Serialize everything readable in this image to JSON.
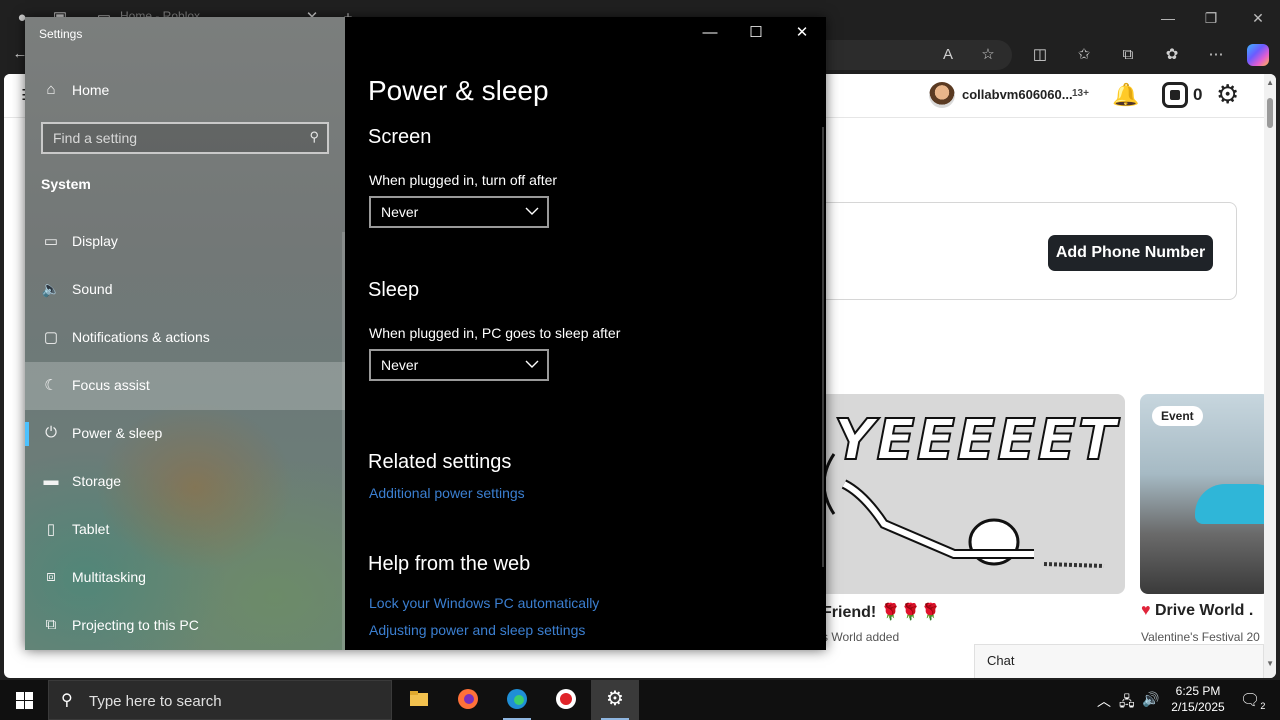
{
  "browser": {
    "tab_title": "Home - Roblox",
    "header": {
      "username": "collabvm606060...",
      "age_badge": "13+",
      "robux_count": "0"
    },
    "phone_button": "Add Phone Number",
    "tiles": [
      {
        "art_text": "YEEEEET",
        "title": "Friend! 🌹🌹🌹",
        "subtitle": "s World added"
      },
      {
        "badge": "Event",
        "title": "Drive World .",
        "subtitle": "Valentine's Festival 20"
      }
    ],
    "chat_label": "Chat"
  },
  "settings": {
    "window_title": "Settings",
    "home_label": "Home",
    "search_placeholder": "Find a setting",
    "section": "System",
    "nav_items": [
      {
        "label": "Display",
        "icon": "display-icon"
      },
      {
        "label": "Sound",
        "icon": "sound-icon"
      },
      {
        "label": "Notifications & actions",
        "icon": "notifications-icon"
      },
      {
        "label": "Focus assist",
        "icon": "moon-icon"
      },
      {
        "label": "Power & sleep",
        "icon": "power-icon"
      },
      {
        "label": "Storage",
        "icon": "storage-icon"
      },
      {
        "label": "Tablet",
        "icon": "tablet-icon"
      },
      {
        "label": "Multitasking",
        "icon": "multitasking-icon"
      },
      {
        "label": "Projecting to this PC",
        "icon": "projecting-icon"
      }
    ],
    "selected_item": "Power & sleep",
    "content": {
      "title": "Power & sleep",
      "screen_heading": "Screen",
      "screen_label": "When plugged in, turn off after",
      "screen_value": "Never",
      "sleep_heading": "Sleep",
      "sleep_label": "When plugged in, PC goes to sleep after",
      "sleep_value": "Never",
      "related_heading": "Related settings",
      "related_link": "Additional power settings",
      "help_heading": "Help from the web",
      "help_links": [
        "Lock your Windows PC automatically",
        "Adjusting power and sleep settings"
      ]
    }
  },
  "taskbar": {
    "search_placeholder": "Type here to search",
    "time": "6:25 PM",
    "date": "2/15/2025",
    "notification_count": "2"
  },
  "colors": {
    "accent": "#4cc2ff",
    "link": "#3b7fd1",
    "content_bg": "#000000"
  }
}
